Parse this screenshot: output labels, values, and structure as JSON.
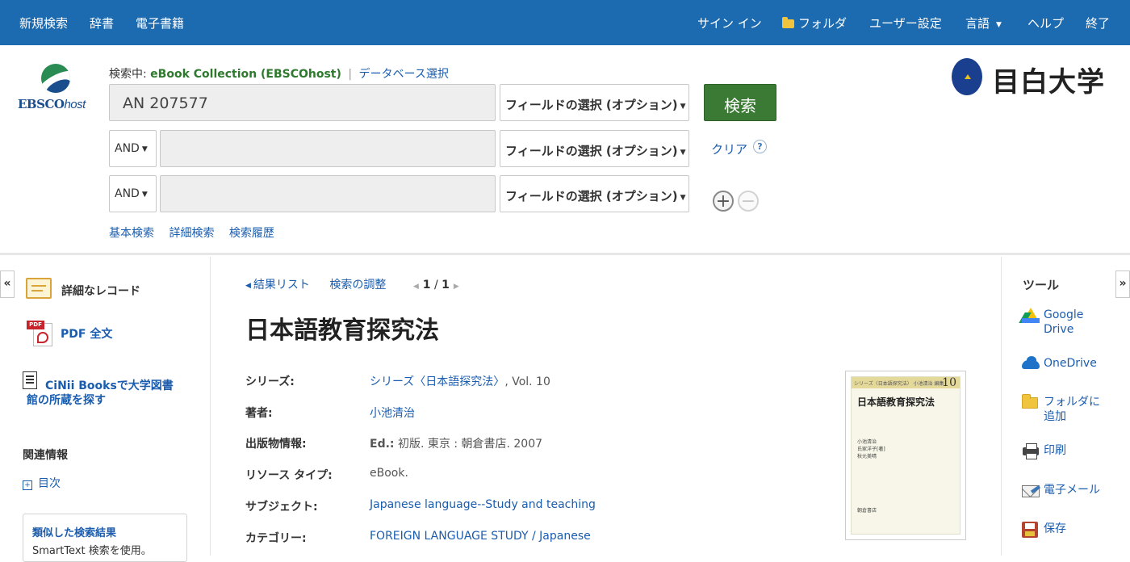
{
  "topnav": {
    "left": [
      "新規検索",
      "辞書",
      "電子書籍"
    ],
    "signin": "サイン イン",
    "folder": "フォルダ",
    "prefs": "ユーザー設定",
    "language": "言語",
    "help": "ヘルプ",
    "exit": "終了"
  },
  "logo": {
    "brand": "EBSCO",
    "suffix": "host"
  },
  "search": {
    "searching_label": "検索中:",
    "database": "eBook Collection (EBSCOhost)",
    "separator": "|",
    "choose_db": "データベース選択",
    "rows": [
      {
        "bool": "",
        "term": "AN 207577",
        "field": "フィールドの選択 (オプション)"
      },
      {
        "bool": "AND",
        "term": "",
        "field": "フィールドの選択 (オプション)"
      },
      {
        "bool": "AND",
        "term": "",
        "field": "フィールドの選択 (オプション)"
      }
    ],
    "search_button": "検索",
    "clear": "クリア",
    "help_glyph": "?",
    "add_glyph": "+",
    "remove_glyph": "−",
    "links": [
      "基本検索",
      "詳細検索",
      "検索履歴"
    ]
  },
  "university": {
    "name": "目白大学"
  },
  "toggles": {
    "left": "«",
    "right": "»"
  },
  "left_panel": {
    "detailed_record": "詳細なレコード",
    "pdf_full_text": "PDF 全文",
    "pdf_tag": "PDF",
    "cinii_line1": "CiNii Booksで大学図書",
    "cinii_line2": "館の所蔵を探す",
    "related": "関連情報",
    "toc": "目次",
    "similar_title": "類似した検索結果",
    "similar_sub": "SmartText 検索を使用。"
  },
  "record_nav": {
    "results_list": "結果リスト",
    "refine": "検索の調整",
    "position": "1",
    "total": "1"
  },
  "record": {
    "title": "日本語教育探究法",
    "fields": [
      {
        "label": "シリーズ:",
        "link": "シリーズ〈日本語探究法〉",
        "text": ", Vol. 10"
      },
      {
        "label": "著者:",
        "link": "小池清治",
        "text": ""
      },
      {
        "label": "出版物情報:",
        "bold": "Ed.:",
        "text": " 初版. 東京 : 朝倉書店. 2007"
      },
      {
        "label": "リソース タイプ:",
        "text": "eBook."
      },
      {
        "label": "サブジェクト:",
        "link": "Japanese language--Study and teaching",
        "text": ""
      },
      {
        "label": "カテゴリー:",
        "link": "FOREIGN LANGUAGE STUDY / Japanese",
        "text": ""
      }
    ]
  },
  "cover": {
    "band": "シリーズ〈日本語探究法〉 小池清治 編集",
    "number": "10",
    "title": "日本語教育探究法",
    "authors": [
      "小池清治",
      "氏家洋子",
      "秋元美晴"
    ],
    "author_note": "[著]",
    "publisher": "朝倉書店"
  },
  "tools": {
    "heading": "ツール",
    "google_drive_1": "Google",
    "google_drive_2": "Drive",
    "onedrive": "OneDrive",
    "folder_add_1": "フォルダに",
    "folder_add_2": "追加",
    "print": "印刷",
    "email": "電子メール",
    "save": "保存"
  },
  "colors": {
    "topbar": "#1c6aaf",
    "search_button": "#3b7a34",
    "link": "#1a5cae"
  }
}
